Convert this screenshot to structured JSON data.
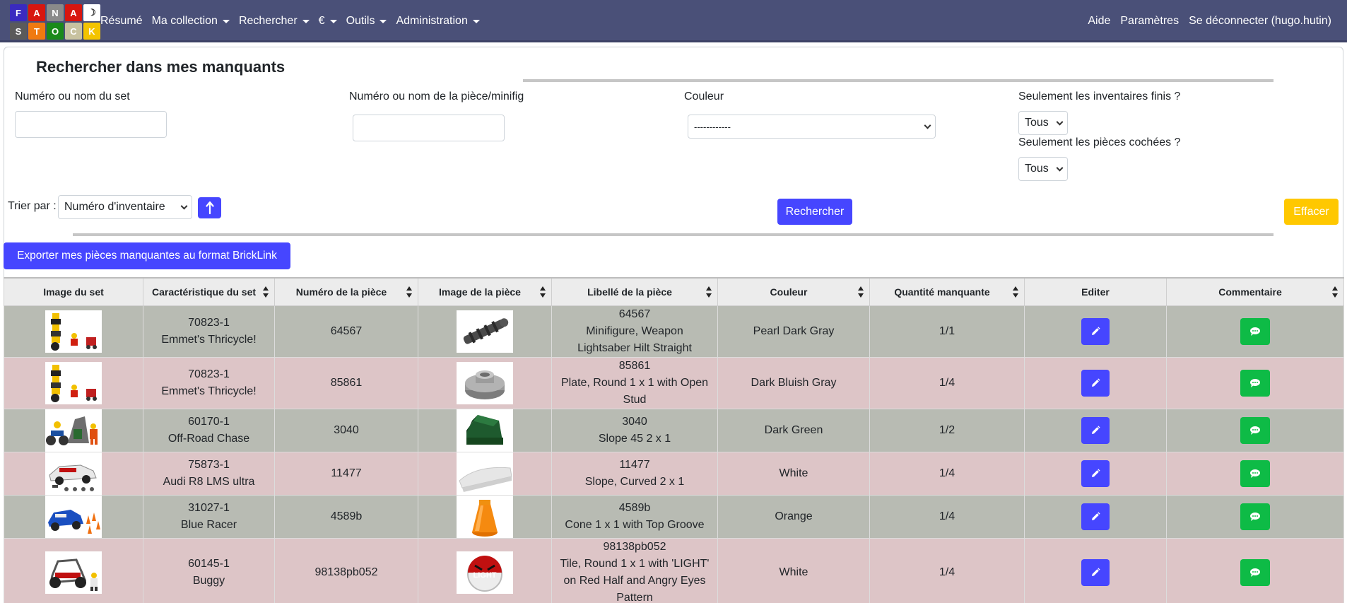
{
  "nav": {
    "logo_letters_top": [
      "F",
      "A",
      "N",
      "A",
      "☽"
    ],
    "logo_letters_bottom": [
      "S",
      "T",
      "O",
      "C",
      "K"
    ],
    "left": [
      {
        "label": "Résumé",
        "dropdown": false
      },
      {
        "label": "Ma collection",
        "dropdown": true
      },
      {
        "label": "Rechercher",
        "dropdown": true
      },
      {
        "label": "€",
        "dropdown": true
      },
      {
        "label": "Outils",
        "dropdown": true
      },
      {
        "label": "Administration",
        "dropdown": true
      }
    ],
    "right": [
      {
        "label": "Aide"
      },
      {
        "label": "Paramètres"
      },
      {
        "label": "Se déconnecter (hugo.hutin)"
      }
    ]
  },
  "page": {
    "title": "Rechercher dans mes manquants"
  },
  "filters": {
    "set_label": "Numéro ou nom du set",
    "set_value": "",
    "part_label": "Numéro ou nom de la pièce/minifig",
    "part_value": "",
    "color_label": "Couleur",
    "color_value": "------------",
    "finished_label": "Seulement les inventaires finis ?",
    "finished_value": "Tous",
    "checked_label": "Seulement les pièces cochées ?",
    "checked_value": "Tous",
    "sort_label": "Trier par :",
    "sort_value": "Numéro d'inventaire",
    "sort_dir_icon": "arrow-up-icon",
    "search_button": "Rechercher",
    "clear_button": "Effacer"
  },
  "export_button": "Exporter mes pièces manquantes au format BrickLink",
  "table": {
    "headers": [
      {
        "label": "Image du set",
        "sortable": false
      },
      {
        "label": "Caractéristique du set",
        "sortable": true
      },
      {
        "label": "Numéro de la pièce",
        "sortable": true
      },
      {
        "label": "Image de la pièce",
        "sortable": true
      },
      {
        "label": "Libellé de la pièce",
        "sortable": true
      },
      {
        "label": "Couleur",
        "sortable": true
      },
      {
        "label": "Quantité manquante",
        "sortable": true
      },
      {
        "label": "Editer",
        "sortable": false
      },
      {
        "label": "Commentaire",
        "sortable": true
      }
    ],
    "rows": [
      {
        "set_number": "70823-1",
        "set_name": "Emmet's Thricycle!",
        "part_number": "64567",
        "part_label_lines": [
          "64567",
          "Minifigure, Weapon",
          "Lightsaber Hilt Straight"
        ],
        "color": "Pearl Dark Gray",
        "qty": "1/1",
        "tone": "gray",
        "set_img": "tricycle",
        "part_img": "lightsaber"
      },
      {
        "set_number": "70823-1",
        "set_name": "Emmet's Thricycle!",
        "part_number": "85861",
        "part_label_lines": [
          "85861",
          "Plate, Round 1 x 1 with Open",
          "Stud"
        ],
        "color": "Dark Bluish Gray",
        "qty": "1/4",
        "tone": "pink",
        "set_img": "tricycle",
        "part_img": "round-plate"
      },
      {
        "set_number": "60170-1",
        "set_name": "Off-Road Chase",
        "part_number": "3040",
        "part_label_lines": [
          "3040",
          "Slope 45 2 x 1"
        ],
        "color": "Dark Green",
        "qty": "1/2",
        "tone": "gray",
        "set_img": "offroad",
        "part_img": "slope"
      },
      {
        "set_number": "75873-1",
        "set_name": "Audi R8 LMS ultra",
        "part_number": "11477",
        "part_label_lines": [
          "11477",
          "Slope, Curved 2 x 1"
        ],
        "color": "White",
        "qty": "1/4",
        "tone": "pink",
        "set_img": "audi",
        "part_img": "curved-slope"
      },
      {
        "set_number": "31027-1",
        "set_name": "Blue Racer",
        "part_number": "4589b",
        "part_label_lines": [
          "4589b",
          "Cone 1 x 1 with Top Groove"
        ],
        "color": "Orange",
        "qty": "1/4",
        "tone": "gray",
        "set_img": "racer",
        "part_img": "cone"
      },
      {
        "set_number": "60145-1",
        "set_name": "Buggy",
        "part_number": "98138pb052",
        "part_label_lines": [
          "98138pb052",
          "Tile, Round 1 x 1 with 'LIGHT'",
          "on Red Half and Angry Eyes",
          "Pattern"
        ],
        "color": "White",
        "qty": "1/4",
        "tone": "pink",
        "set_img": "buggy",
        "part_img": "light-tile",
        "tile_text": "LIGHT"
      }
    ]
  }
}
